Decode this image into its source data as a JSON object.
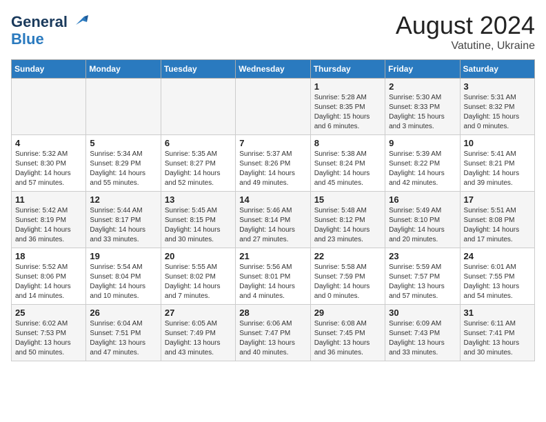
{
  "header": {
    "logo_line1": "General",
    "logo_line2": "Blue",
    "month_year": "August 2024",
    "location": "Vatutine, Ukraine"
  },
  "days_of_week": [
    "Sunday",
    "Monday",
    "Tuesday",
    "Wednesday",
    "Thursday",
    "Friday",
    "Saturday"
  ],
  "weeks": [
    [
      {
        "day": "",
        "info": ""
      },
      {
        "day": "",
        "info": ""
      },
      {
        "day": "",
        "info": ""
      },
      {
        "day": "",
        "info": ""
      },
      {
        "day": "1",
        "info": "Sunrise: 5:28 AM\nSunset: 8:35 PM\nDaylight: 15 hours\nand 6 minutes."
      },
      {
        "day": "2",
        "info": "Sunrise: 5:30 AM\nSunset: 8:33 PM\nDaylight: 15 hours\nand 3 minutes."
      },
      {
        "day": "3",
        "info": "Sunrise: 5:31 AM\nSunset: 8:32 PM\nDaylight: 15 hours\nand 0 minutes."
      }
    ],
    [
      {
        "day": "4",
        "info": "Sunrise: 5:32 AM\nSunset: 8:30 PM\nDaylight: 14 hours\nand 57 minutes."
      },
      {
        "day": "5",
        "info": "Sunrise: 5:34 AM\nSunset: 8:29 PM\nDaylight: 14 hours\nand 55 minutes."
      },
      {
        "day": "6",
        "info": "Sunrise: 5:35 AM\nSunset: 8:27 PM\nDaylight: 14 hours\nand 52 minutes."
      },
      {
        "day": "7",
        "info": "Sunrise: 5:37 AM\nSunset: 8:26 PM\nDaylight: 14 hours\nand 49 minutes."
      },
      {
        "day": "8",
        "info": "Sunrise: 5:38 AM\nSunset: 8:24 PM\nDaylight: 14 hours\nand 45 minutes."
      },
      {
        "day": "9",
        "info": "Sunrise: 5:39 AM\nSunset: 8:22 PM\nDaylight: 14 hours\nand 42 minutes."
      },
      {
        "day": "10",
        "info": "Sunrise: 5:41 AM\nSunset: 8:21 PM\nDaylight: 14 hours\nand 39 minutes."
      }
    ],
    [
      {
        "day": "11",
        "info": "Sunrise: 5:42 AM\nSunset: 8:19 PM\nDaylight: 14 hours\nand 36 minutes."
      },
      {
        "day": "12",
        "info": "Sunrise: 5:44 AM\nSunset: 8:17 PM\nDaylight: 14 hours\nand 33 minutes."
      },
      {
        "day": "13",
        "info": "Sunrise: 5:45 AM\nSunset: 8:15 PM\nDaylight: 14 hours\nand 30 minutes."
      },
      {
        "day": "14",
        "info": "Sunrise: 5:46 AM\nSunset: 8:14 PM\nDaylight: 14 hours\nand 27 minutes."
      },
      {
        "day": "15",
        "info": "Sunrise: 5:48 AM\nSunset: 8:12 PM\nDaylight: 14 hours\nand 23 minutes."
      },
      {
        "day": "16",
        "info": "Sunrise: 5:49 AM\nSunset: 8:10 PM\nDaylight: 14 hours\nand 20 minutes."
      },
      {
        "day": "17",
        "info": "Sunrise: 5:51 AM\nSunset: 8:08 PM\nDaylight: 14 hours\nand 17 minutes."
      }
    ],
    [
      {
        "day": "18",
        "info": "Sunrise: 5:52 AM\nSunset: 8:06 PM\nDaylight: 14 hours\nand 14 minutes."
      },
      {
        "day": "19",
        "info": "Sunrise: 5:54 AM\nSunset: 8:04 PM\nDaylight: 14 hours\nand 10 minutes."
      },
      {
        "day": "20",
        "info": "Sunrise: 5:55 AM\nSunset: 8:02 PM\nDaylight: 14 hours\nand 7 minutes."
      },
      {
        "day": "21",
        "info": "Sunrise: 5:56 AM\nSunset: 8:01 PM\nDaylight: 14 hours\nand 4 minutes."
      },
      {
        "day": "22",
        "info": "Sunrise: 5:58 AM\nSunset: 7:59 PM\nDaylight: 14 hours\nand 0 minutes."
      },
      {
        "day": "23",
        "info": "Sunrise: 5:59 AM\nSunset: 7:57 PM\nDaylight: 13 hours\nand 57 minutes."
      },
      {
        "day": "24",
        "info": "Sunrise: 6:01 AM\nSunset: 7:55 PM\nDaylight: 13 hours\nand 54 minutes."
      }
    ],
    [
      {
        "day": "25",
        "info": "Sunrise: 6:02 AM\nSunset: 7:53 PM\nDaylight: 13 hours\nand 50 minutes."
      },
      {
        "day": "26",
        "info": "Sunrise: 6:04 AM\nSunset: 7:51 PM\nDaylight: 13 hours\nand 47 minutes."
      },
      {
        "day": "27",
        "info": "Sunrise: 6:05 AM\nSunset: 7:49 PM\nDaylight: 13 hours\nand 43 minutes."
      },
      {
        "day": "28",
        "info": "Sunrise: 6:06 AM\nSunset: 7:47 PM\nDaylight: 13 hours\nand 40 minutes."
      },
      {
        "day": "29",
        "info": "Sunrise: 6:08 AM\nSunset: 7:45 PM\nDaylight: 13 hours\nand 36 minutes."
      },
      {
        "day": "30",
        "info": "Sunrise: 6:09 AM\nSunset: 7:43 PM\nDaylight: 13 hours\nand 33 minutes."
      },
      {
        "day": "31",
        "info": "Sunrise: 6:11 AM\nSunset: 7:41 PM\nDaylight: 13 hours\nand 30 minutes."
      }
    ]
  ]
}
